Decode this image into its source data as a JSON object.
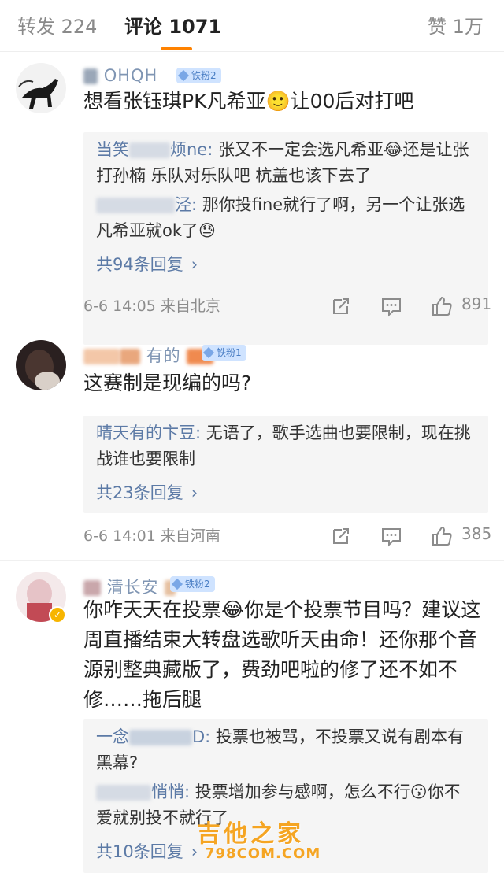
{
  "tabs": {
    "repost": "转发 224",
    "comments": "评论 1071",
    "likes": "赞 1万"
  },
  "colors": {
    "accent": "#ff8200",
    "link": "#5c7aa6",
    "meta": "#8c8c8c"
  },
  "comments": [
    {
      "username_visible": "OHQH",
      "fan_badge": "铁粉2",
      "text": "想看张钰琪PK凡希亚🙂让00后对打吧",
      "replies": [
        {
          "name": "当笑",
          "name_tail": "烦ne:",
          "text": " 张又不一定会选凡希亚😂还是让张打孙楠 乐队对乐队吧 杭盖也该下去了"
        },
        {
          "name": "",
          "name_tail": "泾:",
          "text": " 那你投fine就行了啊，另一个让张选凡希亚就ok了😓"
        }
      ],
      "more_replies": "共94条回复",
      "time": "6-6 14:05 来自北京",
      "likes": "891"
    },
    {
      "username_visible": "有的",
      "fan_badge": "铁粉1",
      "text": "这赛制是现编的吗?",
      "replies": [
        {
          "name": "晴天有的",
          "name_tail": "卞豆:",
          "text": " 无语了，歌手选曲也要限制，现在挑战谁也要限制"
        }
      ],
      "more_replies": "共23条回复",
      "time": "6-6 14:01 来自河南",
      "likes": "385"
    },
    {
      "username_visible": "清长安",
      "fan_badge": "铁粉2",
      "text": "你咋天天在投票😂你是个投票节目吗？建议这周直播结束大转盘选歌听天由命！还你那个音源别整典藏版了，费劲吧啦的修了还不如不修……拖后腿",
      "replies": [
        {
          "name": "一念",
          "name_tail": "D:",
          "text": " 投票也被骂，不投票又说有剧本有黑幕?"
        },
        {
          "name": "",
          "name_tail": "悄悄:",
          "text": " 投票增加参与感啊，怎么不行😗你不爱就别投不就行了"
        }
      ],
      "more_replies": "共10条回复"
    }
  ],
  "watermark": {
    "title": "吉他之家",
    "sub": "798COM.COM"
  },
  "icons": [
    "repost-icon",
    "comment-icon",
    "like-icon",
    "chevron-right-icon"
  ]
}
